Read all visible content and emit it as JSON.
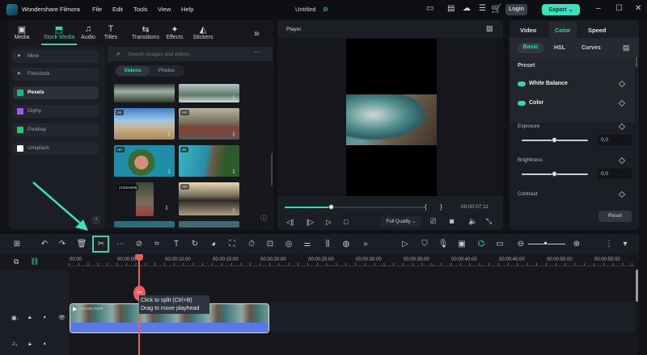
{
  "app": {
    "title": "Wondershare Filmora",
    "project": "Untitled",
    "menu": [
      "File",
      "Edit",
      "Tools",
      "View",
      "Help"
    ],
    "login": "Login",
    "export": "Export ⌄"
  },
  "tabs": [
    {
      "label": "Media",
      "icon": "▣"
    },
    {
      "label": "Stock Media",
      "icon": "⬒"
    },
    {
      "label": "Audio",
      "icon": "♫"
    },
    {
      "label": "Titles",
      "icon": "T"
    },
    {
      "label": "Transitions",
      "icon": "⇆"
    },
    {
      "label": "Effects",
      "icon": "✦"
    },
    {
      "label": "Stickers",
      "icon": "◭"
    }
  ],
  "sidebar": [
    {
      "label": "Mine",
      "type": "folder"
    },
    {
      "label": "Filmstock",
      "type": "folder"
    },
    {
      "label": "Pexels",
      "color": "#1db584"
    },
    {
      "label": "Giphy",
      "color": "#9b59ff"
    },
    {
      "label": "Pixabay",
      "color": "#2ec66b"
    },
    {
      "label": "Unsplash",
      "color": "#ffffff"
    }
  ],
  "search": {
    "placeholder": "Search images and videos"
  },
  "media_tabs": [
    "Videos",
    "Photos"
  ],
  "thumbs": [
    {
      "badge": ""
    },
    {
      "badge": ""
    },
    {
      "badge": "4K"
    },
    {
      "badge": "HD"
    },
    {
      "badge": "HD"
    },
    {
      "badge": "4K"
    },
    {
      "badge": "2160x4096"
    },
    {
      "badge": "HD"
    }
  ],
  "player": {
    "label": "Player",
    "time": "00:00:07:11",
    "quality": "Full Quality ⌄",
    "progress": 0.33
  },
  "right": {
    "tabs": [
      "Video",
      "Color",
      "Speed"
    ],
    "subtabs": [
      "Basic",
      "HSL",
      "Curves"
    ],
    "preset": "Preset",
    "toggles": [
      "White Balance",
      "Color"
    ],
    "params": [
      {
        "label": "Exposure",
        "value": "0,0"
      },
      {
        "label": "Brightness",
        "value": "0,0"
      },
      {
        "label": "Contrast"
      }
    ],
    "reset": "Reset"
  },
  "timeline": {
    "ticks": [
      "00:00",
      "00:00:05:00",
      "00:00:10:00",
      "00:00:15:00",
      "00:00:20:00",
      "00:00:25:00",
      "00:00:30:00",
      "00:00:35:00",
      "00:00:40:00",
      "00:00:45:00",
      "00:00:50:00",
      "00:00:55:00"
    ],
    "tooltip": [
      "Click to split (Ctrl+B)",
      "Drag to move playhead"
    ],
    "clip_label": "ocean.mp4"
  },
  "colors": {
    "accent": "#38d4b0",
    "playhead": "#f25a5a",
    "audio": "#5b78e8"
  }
}
